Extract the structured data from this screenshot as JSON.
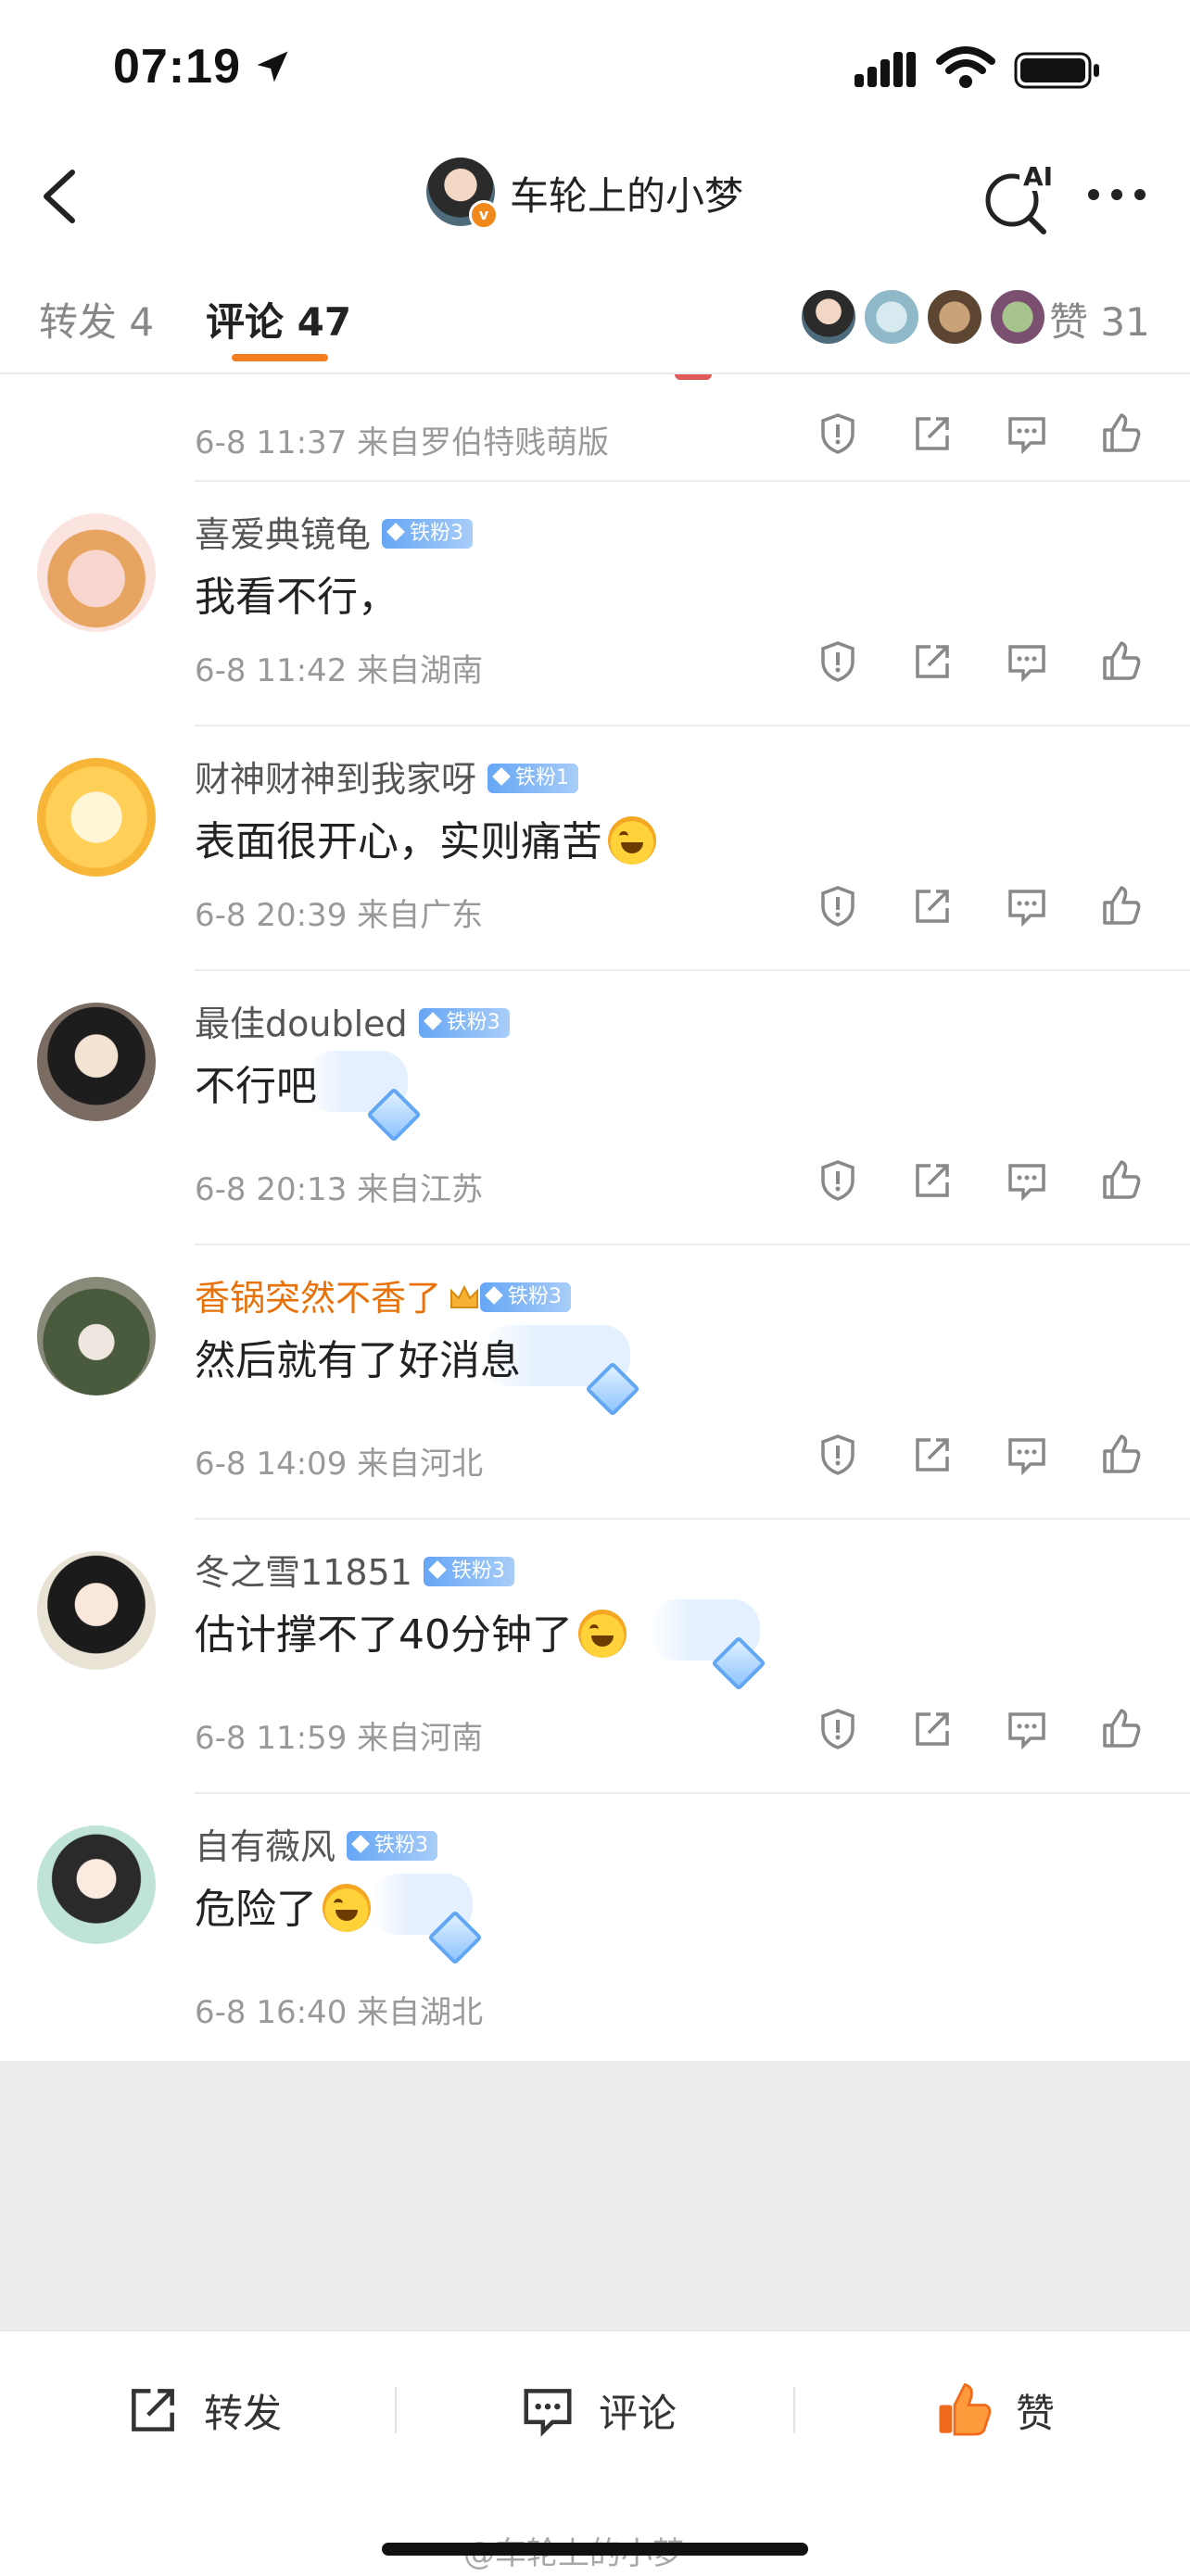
{
  "status_bar": {
    "time": "07:19"
  },
  "nav": {
    "title": "车轮上的小梦",
    "ai_label": "AI"
  },
  "tabs": {
    "repost": "转发 4",
    "comment": "评论 47",
    "likes": "赞 31"
  },
  "comments": [
    {
      "meta": "6-8 11:37  来自罗伯特贱萌版"
    },
    {
      "user": "喜爱典镜龟",
      "badge": "铁粉3",
      "text": "我看不行，",
      "meta": "6-8 11:42  来自湖南"
    },
    {
      "user": "财神财神到我家呀",
      "badge": "铁粉1",
      "text": "表面很开心，实则痛苦",
      "meta": "6-8 20:39  来自广东"
    },
    {
      "user": "最佳doubled",
      "badge": "铁粉3",
      "text": "不行吧",
      "meta": "6-8 20:13  来自江苏"
    },
    {
      "user": "香锅突然不香了",
      "badge": "铁粉3",
      "text": "然后就有了好消息",
      "meta": "6-8 14:09  来自河北"
    },
    {
      "user": "冬之雪11851",
      "badge": "铁粉3",
      "text": "估计撑不了40分钟了",
      "meta": "6-8 11:59  来自河南"
    },
    {
      "user": "自有薇风",
      "badge": "铁粉3",
      "text": "危险了",
      "meta": "6-8 16:40  来自湖北"
    }
  ],
  "bottom_bar": {
    "repost": "转发",
    "comment": "评论",
    "like": "赞"
  },
  "watermark": "@车轮上的小梦",
  "colors": {
    "accent": "#f27e20",
    "gold_name": "#e8710a",
    "badge_blue": "#66a6f5"
  }
}
